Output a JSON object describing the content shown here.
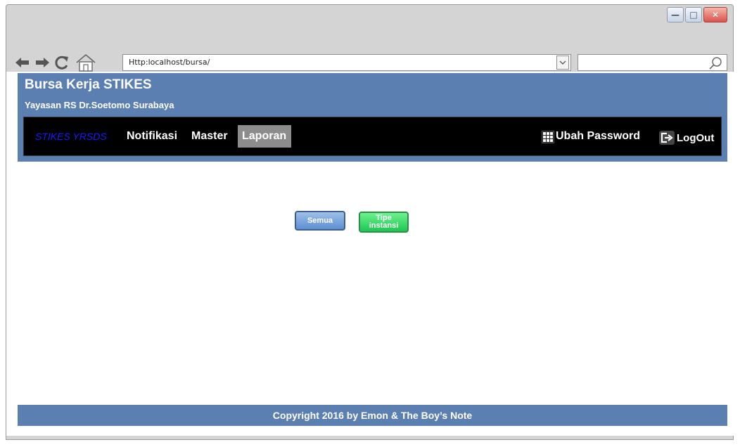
{
  "window": {
    "controls": {
      "minimize": "—",
      "maximize": "□",
      "close": "✕"
    }
  },
  "browser": {
    "url": "Http:localhost/bursa/",
    "search_placeholder": ""
  },
  "header": {
    "title": "Bursa Kerja STIKES",
    "subtitle": "Yayasan RS Dr.Soetomo Surabaya"
  },
  "navbar": {
    "brand": "STIKES YRSDS",
    "items": [
      {
        "label": "Notifikasi"
      },
      {
        "label": "Master"
      },
      {
        "label": "Laporan"
      }
    ],
    "change_password": "Ubah Password",
    "logout": "LogOut"
  },
  "main": {
    "buttons": [
      {
        "label": "Semua"
      },
      {
        "label": "Tipe instansi"
      }
    ]
  },
  "footer": {
    "text": "Copyright 2016 by Emon & The Boy’s Note"
  },
  "colors": {
    "header": "#5b7fb0",
    "navbar": "#000000",
    "active_tab": "#8c8c8c",
    "button_blue": "#5e8fd2",
    "button_green": "#1ec652"
  }
}
